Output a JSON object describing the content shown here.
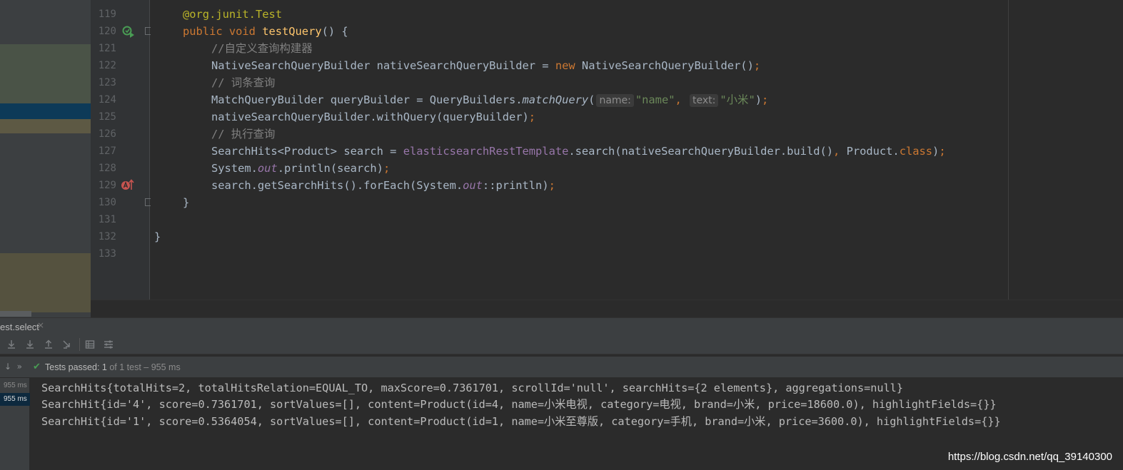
{
  "editor": {
    "line_numbers": [
      "119",
      "120",
      "121",
      "122",
      "123",
      "124",
      "125",
      "126",
      "127",
      "128",
      "129",
      "130",
      "131",
      "132",
      "133"
    ],
    "lines": {
      "l119": {
        "at": "@org.junit.",
        "ann": "Test"
      },
      "l120": {
        "kw": "public void ",
        "fn": "testQuery",
        "rest": "() {"
      },
      "l121": {
        "comment": "//自定义查询构建器"
      },
      "l122": {
        "a": "NativeSearchQueryBuilder nativeSearchQueryBuilder = ",
        "kw": "new",
        "b": " NativeSearchQueryBuilder()",
        "semi": ";"
      },
      "l123": {
        "comment": "// 词条查询"
      },
      "l124": {
        "a": "MatchQueryBuilder queryBuilder = QueryBuilders.",
        "method": "matchQuery",
        "open": "(",
        "hint1": "name:",
        "str1": "\"name\"",
        "comma": ", ",
        "hint2": "text:",
        "str2": "\"小米\"",
        "close": ")",
        "semi": ";"
      },
      "l125": {
        "a": "nativeSearchQueryBuilder.withQuery(queryBuilder)",
        "semi": ";"
      },
      "l126": {
        "comment": "// 执行查询"
      },
      "l127": {
        "a": "SearchHits<Product> search = ",
        "field": "elasticsearchRestTemplate",
        "b": ".search(nativeSearchQueryBuilder.build()",
        "comma": ", ",
        "c": "Product.",
        "kw": "class",
        "d": ")",
        "semi": ";"
      },
      "l128": {
        "a": "System.",
        "out": "out",
        "b": ".println(search)",
        "semi": ";"
      },
      "l129": {
        "a": "search.getSearchHits().forEach(System.",
        "out": "out",
        "b": "::println)",
        "semi": ";"
      },
      "l130": {
        "brace": "}"
      },
      "l132": {
        "brace": "}"
      }
    }
  },
  "run_panel": {
    "tab_label": "est.select",
    "tab_close": "×",
    "status": {
      "prefix": "Tests passed: ",
      "count": "1",
      "suffix": " of 1 test – 955 ms"
    },
    "test_tree": [
      "955 ms",
      "955 ms"
    ],
    "console_lines": [
      "SearchHits{totalHits=2, totalHitsRelation=EQUAL_TO, maxScore=0.7361701, scrollId='null', searchHits={2 elements}, aggregations=null}",
      "SearchHit{id='4', score=0.7361701, sortValues=[], content=Product(id=4, name=小米电视, category=电视, brand=小米, price=18600.0), highlightFields={}}",
      "SearchHit{id='1', score=0.5364054, sortValues=[], content=Product(id=1, name=小米至尊版, category=手机, brand=小米, price=3600.0), highlightFields={}}"
    ],
    "watermark": "https://blog.csdn.net/qq_39140300"
  },
  "colors": {
    "background": "#2b2b2b",
    "keyword": "#cc7832",
    "annotation": "#bbb529",
    "method": "#ffc66d",
    "string": "#6a8759",
    "comment": "#808080",
    "field": "#9876aa",
    "passed": "#499c54"
  }
}
